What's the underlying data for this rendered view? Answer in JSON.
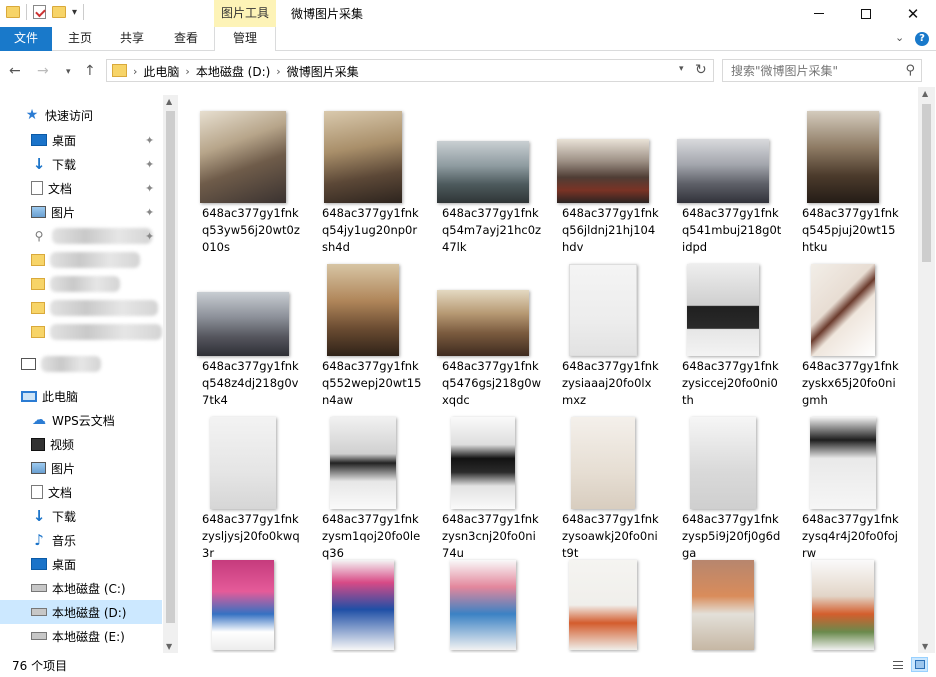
{
  "window": {
    "title": "微博图片采集",
    "tool_tab": "图片工具"
  },
  "ribbon": {
    "tabs": [
      "文件",
      "主页",
      "共享",
      "查看",
      "管理"
    ]
  },
  "address": {
    "crumbs": [
      "此电脑",
      "本地磁盘 (D:)",
      "微博图片采集"
    ]
  },
  "search": {
    "placeholder": "搜索\"微博图片采集\""
  },
  "sidebar": {
    "quick_access": "快速访问",
    "pinned": [
      "桌面",
      "下载",
      "文档",
      "图片"
    ],
    "this_pc": "此电脑",
    "pc_items": [
      "WPS云文档",
      "视频",
      "图片",
      "文档",
      "下载",
      "音乐",
      "桌面",
      "本地磁盘 (C:)",
      "本地磁盘 (D:)",
      "本地磁盘 (E:)"
    ]
  },
  "files": [
    {
      "name": "648ac377gy1fnkq53yw56j20wt0z010s",
      "style": "city-a"
    },
    {
      "name": "648ac377gy1fnkq54jy1ug20np0rsh4d",
      "style": "city-b"
    },
    {
      "name": "648ac377gy1fnkq54m7ayj21hc0z47lk",
      "style": "city-c"
    },
    {
      "name": "648ac377gy1fnkq56jldnj21hj104hdv",
      "style": "city-d"
    },
    {
      "name": "648ac377gy1fnkq541mbuj218g0tidpd",
      "style": "city-e"
    },
    {
      "name": "648ac377gy1fnkq545pjuj20wt15htku",
      "style": "city-f"
    },
    {
      "name": "648ac377gy1fnkq548z4dj218g0v7tk4",
      "style": "city-g"
    },
    {
      "name": "648ac377gy1fnkq552wepj20wt15n4aw",
      "style": "city-h"
    },
    {
      "name": "648ac377gy1fnkq5476gsj218g0wxqdc",
      "style": "city-i"
    },
    {
      "name": "648ac377gy1fnkzysiaaaj20fo0lxmxz",
      "style": "tag-a"
    },
    {
      "name": "648ac377gy1fnkzysiccej20fo0ni0th",
      "style": "tag-b"
    },
    {
      "name": "648ac377gy1fnkzyskx65j20fo0nigmh",
      "style": "tag-c"
    },
    {
      "name": "648ac377gy1fnkzysljysj20fo0kwq3r",
      "style": "tag-d"
    },
    {
      "name": "648ac377gy1fnkzysm1qoj20fo0leq36",
      "style": "tag-e"
    },
    {
      "name": "648ac377gy1fnkzysn3cnj20fo0ni74u",
      "style": "tag-f"
    },
    {
      "name": "648ac377gy1fnkzysoawkj20fo0nit9t",
      "style": "tag-g"
    },
    {
      "name": "648ac377gy1fnkzysp5i9j20fj0g6dga",
      "style": "tag-h"
    },
    {
      "name": "648ac377gy1fnkzysq4r4j20fo0fojrw",
      "style": "tag-i"
    },
    {
      "name": "",
      "style": "flower-a"
    },
    {
      "name": "",
      "style": "flower-b"
    },
    {
      "name": "",
      "style": "flower-c"
    },
    {
      "name": "",
      "style": "flower-d"
    },
    {
      "name": "",
      "style": "flower-e"
    },
    {
      "name": "",
      "style": "flower-f"
    }
  ],
  "status": {
    "item_count": "76 个项目"
  }
}
